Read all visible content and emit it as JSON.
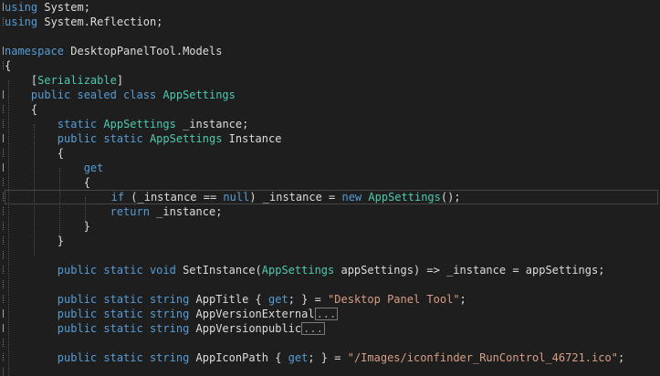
{
  "editor": {
    "lines": [
      {
        "segments": [
          {
            "t": "kw",
            "v": "using"
          },
          {
            "t": "id",
            "v": " System;"
          }
        ]
      },
      {
        "segments": [
          {
            "t": "kw",
            "v": "using"
          },
          {
            "t": "id",
            "v": " System.Reflection;"
          }
        ]
      },
      {
        "segments": []
      },
      {
        "segments": [
          {
            "t": "kw",
            "v": "namespace"
          },
          {
            "t": "id",
            "v": " DesktopPanelTool.Models"
          }
        ]
      },
      {
        "segments": [
          {
            "t": "id",
            "v": "{"
          }
        ]
      },
      {
        "segments": [
          {
            "t": "id",
            "v": "    ["
          },
          {
            "t": "ty",
            "v": "Serializable"
          },
          {
            "t": "id",
            "v": "]"
          }
        ]
      },
      {
        "segments": [
          {
            "t": "kw",
            "v": "    public sealed class"
          },
          {
            "t": "id",
            "v": " "
          },
          {
            "t": "ty",
            "v": "AppSettings"
          }
        ]
      },
      {
        "segments": [
          {
            "t": "id",
            "v": "    {"
          }
        ]
      },
      {
        "segments": [
          {
            "t": "kw",
            "v": "        static"
          },
          {
            "t": "id",
            "v": " "
          },
          {
            "t": "ty",
            "v": "AppSettings"
          },
          {
            "t": "id",
            "v": " _instance;"
          }
        ]
      },
      {
        "segments": [
          {
            "t": "kw",
            "v": "        public static"
          },
          {
            "t": "id",
            "v": " "
          },
          {
            "t": "ty",
            "v": "AppSettings"
          },
          {
            "t": "id",
            "v": " Instance"
          }
        ]
      },
      {
        "segments": [
          {
            "t": "id",
            "v": "        {"
          }
        ]
      },
      {
        "segments": [
          {
            "t": "kw",
            "v": "            get"
          }
        ]
      },
      {
        "segments": [
          {
            "t": "id",
            "v": "            {"
          }
        ]
      },
      {
        "segments": [
          {
            "t": "kw",
            "v": "                if"
          },
          {
            "t": "id",
            "v": " (_instance == "
          },
          {
            "t": "kw",
            "v": "null"
          },
          {
            "t": "id",
            "v": ") _instance = "
          },
          {
            "t": "kw",
            "v": "new"
          },
          {
            "t": "id",
            "v": " "
          },
          {
            "t": "ty",
            "v": "AppSettings"
          },
          {
            "t": "id",
            "v": "();"
          }
        ]
      },
      {
        "segments": [
          {
            "t": "kw",
            "v": "                return"
          },
          {
            "t": "id",
            "v": " _instance;"
          }
        ]
      },
      {
        "segments": [
          {
            "t": "id",
            "v": "            }"
          }
        ]
      },
      {
        "segments": [
          {
            "t": "id",
            "v": "        }"
          }
        ]
      },
      {
        "segments": []
      },
      {
        "segments": [
          {
            "t": "kw",
            "v": "        public static void"
          },
          {
            "t": "id",
            "v": " SetInstance("
          },
          {
            "t": "ty",
            "v": "AppSettings"
          },
          {
            "t": "id",
            "v": " appSettings) => _instance = appSettings;"
          }
        ]
      },
      {
        "segments": []
      },
      {
        "segments": [
          {
            "t": "kw",
            "v": "        public static string"
          },
          {
            "t": "id",
            "v": " AppTitle { "
          },
          {
            "t": "kw",
            "v": "get"
          },
          {
            "t": "id",
            "v": "; } = "
          },
          {
            "t": "st",
            "v": "\"Desktop Panel Tool\""
          },
          {
            "t": "id",
            "v": ";"
          }
        ]
      },
      {
        "segments": [
          {
            "t": "kw",
            "v": "        public static string"
          },
          {
            "t": "id",
            "v": " AppVersionExternal"
          },
          {
            "t": "fold",
            "v": "..."
          }
        ]
      },
      {
        "segments": [
          {
            "t": "kw",
            "v": "        public static string"
          },
          {
            "t": "id",
            "v": " AppVersionpublic"
          },
          {
            "t": "fold",
            "v": "..."
          }
        ]
      },
      {
        "segments": []
      },
      {
        "segments": [
          {
            "t": "kw",
            "v": "        public static string"
          },
          {
            "t": "id",
            "v": " AppIconPath { "
          },
          {
            "t": "kw",
            "v": "get"
          },
          {
            "t": "id",
            "v": "; } = "
          },
          {
            "t": "st",
            "v": "\"/Images/iconfinder_RunControl_46721.ico\""
          },
          {
            "t": "id",
            "v": ";"
          }
        ]
      }
    ]
  },
  "colors": {
    "background": "#1e1e1e",
    "keyword": "#569cd6",
    "type": "#4ec9b0",
    "string": "#d69d85",
    "identifier": "#dcdcdc"
  }
}
